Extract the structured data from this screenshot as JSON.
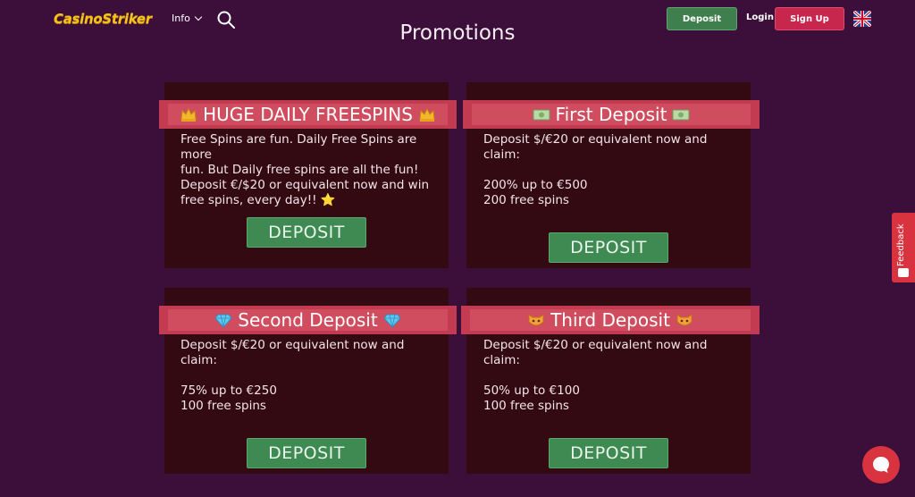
{
  "header": {
    "logo_text": "CasinoStriker",
    "info_label": "Info",
    "deposit_label": "Deposit",
    "login_label": "Login",
    "signup_label": "Sign Up"
  },
  "page": {
    "title": "Promotions"
  },
  "promotions": [
    {
      "title": "HUGE DAILY FREESPINS",
      "emoji": "crown-icon",
      "body": [
        "Free Spins are fun. Daily Free Spins are more",
        "fun. But Daily free spins are all the fun!",
        "Deposit €/$20 or equivalent now and win",
        "free spins, every day!! ⭐"
      ],
      "button": "DEPOSIT"
    },
    {
      "title": "First Deposit",
      "emoji": "money-icon",
      "body": [
        "Deposit $/€20 or equivalent now and claim:",
        "",
        "200% up to €500",
        "200 free spins"
      ],
      "button": "DEPOSIT"
    },
    {
      "title": "Second Deposit",
      "emoji": "diamond-icon",
      "body": [
        "Deposit $/€20 or equivalent now and claim:",
        "",
        "75% up to €250",
        "100 free spins"
      ],
      "button": "DEPOSIT"
    },
    {
      "title": "Third Deposit",
      "emoji": "cat-face-icon",
      "body": [
        "Deposit $/€20 or equivalent now and claim:",
        "",
        "50% up to €100",
        "100 free spins"
      ],
      "button": "DEPOSIT"
    }
  ],
  "feedback": {
    "label": "Feedback"
  },
  "colors": {
    "background": "#3b0f3a",
    "card": "#330a11",
    "card_header": "#c23b50",
    "deposit_green": "#3e8a52",
    "signup_red": "#c7264d",
    "logo_yellow": "#f7c21a"
  }
}
